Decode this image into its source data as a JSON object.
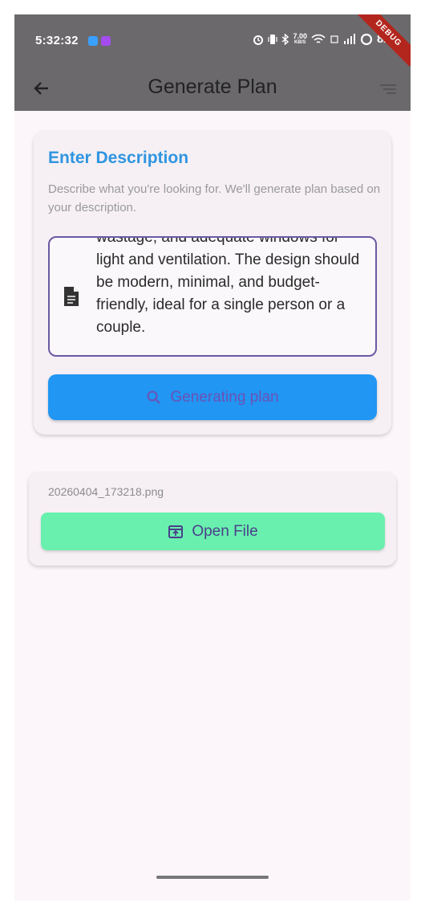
{
  "status_bar": {
    "time": "5:32:32",
    "network_speed_value": "7.00",
    "network_speed_unit": "KB/S",
    "battery_text": "82%"
  },
  "debug_banner": "DEBUG",
  "app_bar": {
    "title": "Generate Plan"
  },
  "description_card": {
    "title": "Enter Description",
    "subtitle": "Describe what you're looking for. We'll generate plan based on your description.",
    "description_text": "wastage, and adequate windows for light and ventilation. The design should be modern, minimal, and budget-friendly, ideal for a single person or a couple.",
    "generate_button_label": "Generating plan"
  },
  "file_card": {
    "file_name": "20260404_173218.png",
    "open_button_label": "Open File"
  },
  "colors": {
    "accent_blue": "#2196f3",
    "title_blue": "#2f95e1",
    "open_green": "#69f0ae",
    "border_purple": "#6b59a3",
    "app_bar": "#6b696c"
  }
}
